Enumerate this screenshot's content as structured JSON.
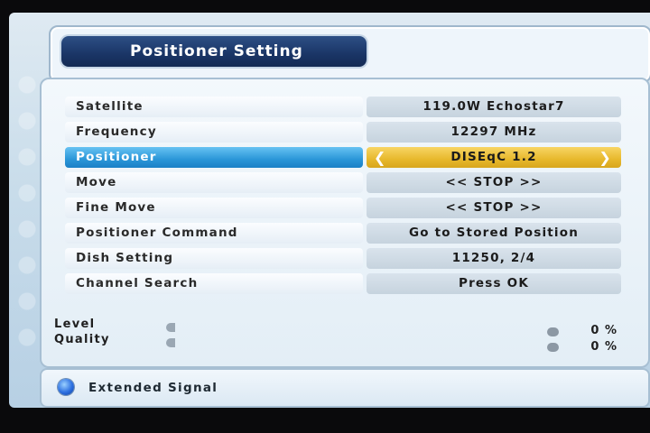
{
  "header": {
    "title": "Positioner Setting"
  },
  "menu": [
    {
      "label": "Satellite",
      "value": "119.0W Echostar7"
    },
    {
      "label": "Frequency",
      "value": "12297 MHz"
    },
    {
      "label": "Positioner",
      "value": "DISEqC 1.2",
      "selected": true
    },
    {
      "label": "Move",
      "value": "<<  STOP  >>"
    },
    {
      "label": "Fine Move",
      "value": "<<  STOP  >>"
    },
    {
      "label": "Positioner Command",
      "value": "Go to Stored Position"
    },
    {
      "label": "Dish Setting",
      "value": "11250, 2/4"
    },
    {
      "label": "Channel Search",
      "value": "Press OK"
    }
  ],
  "signal": {
    "level_label": "Level",
    "quality_label": "Quality",
    "level_percent": "0 %",
    "quality_percent": "0 %",
    "level_value": 0,
    "quality_value": 0
  },
  "footer": {
    "extended_signal": "Extended Signal"
  },
  "icons": {
    "left_arrow": "chevron-left-icon",
    "right_arrow": "chevron-right-icon",
    "blue_button": "blue-button-icon"
  },
  "colors": {
    "title_bg": "#1a3566",
    "selected_label": "#2a96d8",
    "selected_value": "#e7b82c"
  }
}
